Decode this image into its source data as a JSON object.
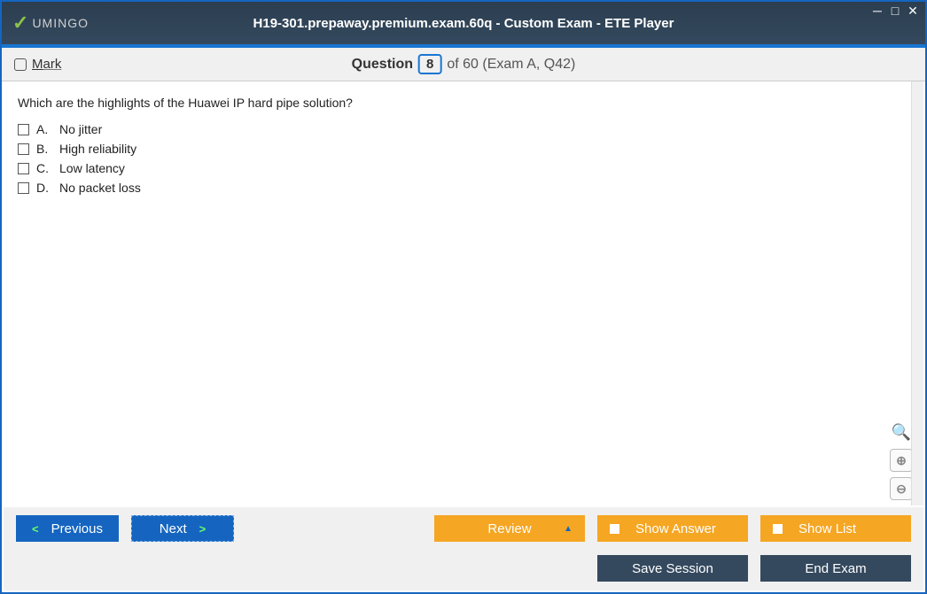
{
  "titlebar": {
    "logo_text": "UMINGO",
    "title": "H19-301.prepaway.premium.exam.60q - Custom Exam - ETE Player"
  },
  "question_bar": {
    "mark_label": "Mark",
    "question_word": "Question",
    "current_number": "8",
    "suffix": "of 60 (Exam A, Q42)"
  },
  "question": {
    "text": "Which are the highlights of the Huawei IP hard pipe solution?",
    "options": [
      {
        "letter": "A.",
        "text": "No jitter"
      },
      {
        "letter": "B.",
        "text": "High reliability"
      },
      {
        "letter": "C.",
        "text": "Low latency"
      },
      {
        "letter": "D.",
        "text": "No packet loss"
      }
    ]
  },
  "buttons": {
    "previous": "Previous",
    "next": "Next",
    "review": "Review",
    "show_answer": "Show Answer",
    "show_list": "Show List",
    "save_session": "Save Session",
    "end_exam": "End Exam"
  }
}
